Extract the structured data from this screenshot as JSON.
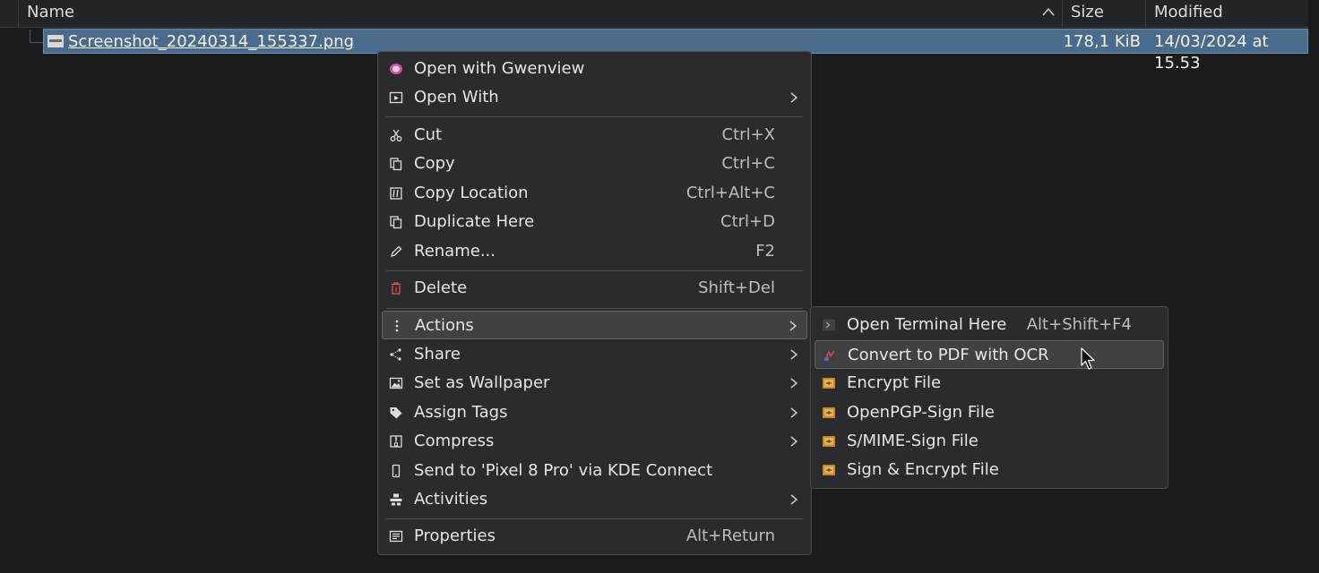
{
  "columns": {
    "name": "Name",
    "size": "Size",
    "modified": "Modified"
  },
  "file": {
    "name": "Screenshot_20240314_155337.png",
    "size": "178,1 KiB",
    "modified": "14/03/2024 at 15.53"
  },
  "menu": {
    "open_with_gwenview": "Open with Gwenview",
    "open_with": "Open With",
    "cut": "Cut",
    "cut_sc": "Ctrl+X",
    "copy": "Copy",
    "copy_sc": "Ctrl+C",
    "copy_location": "Copy Location",
    "copy_location_sc": "Ctrl+Alt+C",
    "duplicate": "Duplicate Here",
    "duplicate_sc": "Ctrl+D",
    "rename": "Rename...",
    "rename_sc": "F2",
    "delete": "Delete",
    "delete_sc": "Shift+Del",
    "actions": "Actions",
    "share": "Share",
    "wallpaper": "Set as Wallpaper",
    "tags": "Assign Tags",
    "compress": "Compress",
    "kde_connect": "Send to 'Pixel 8 Pro' via KDE Connect",
    "activities": "Activities",
    "properties": "Properties",
    "properties_sc": "Alt+Return"
  },
  "submenu": {
    "terminal": "Open Terminal Here",
    "terminal_sc": "Alt+Shift+F4",
    "pdf_ocr": "Convert to PDF with OCR",
    "encrypt": "Encrypt File",
    "pgp_sign": "OpenPGP-Sign File",
    "smime_sign": "S/MIME-Sign File",
    "sign_encrypt": "Sign & Encrypt File"
  },
  "colors": {
    "selection": "#4a6b8a",
    "menu_bg": "#2a2b2c",
    "delete_icon": "#e05555",
    "gwenview_icon": "#d04fa8"
  },
  "icons": [
    "gwenview-icon",
    "open-with-icon",
    "cut-icon",
    "copy-icon",
    "copy-location-icon",
    "duplicate-icon",
    "rename-icon",
    "delete-icon",
    "actions-icon",
    "share-icon",
    "wallpaper-icon",
    "tag-icon",
    "compress-icon",
    "phone-icon",
    "activities-icon",
    "properties-icon",
    "terminal-icon",
    "pdf-icon",
    "kgpg-icon"
  ]
}
